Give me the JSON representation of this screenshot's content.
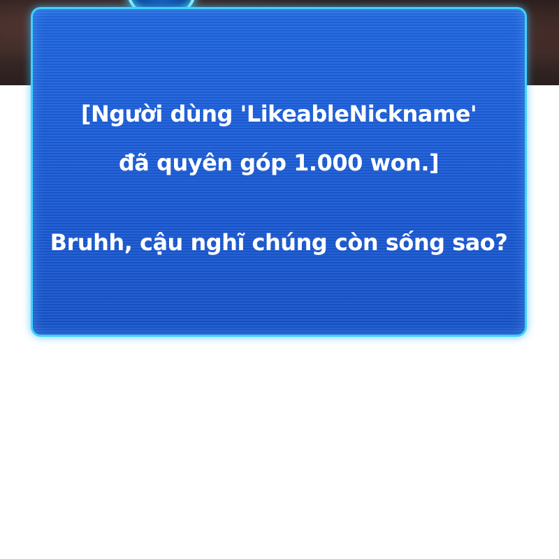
{
  "dialog": {
    "lines": [
      "[Người dùng 'LikeableNickname'",
      "đã quyên góp 1.000 won.]",
      "Bruhh, cậu nghĩ chúng còn sống sao?"
    ]
  },
  "colors": {
    "panel_fill": "#1a5bd6",
    "panel_border": "#3fd2ff",
    "text": "#ffffff",
    "background": "#ffffff"
  },
  "icons": {
    "top_orb": "glowing-orb-icon"
  }
}
